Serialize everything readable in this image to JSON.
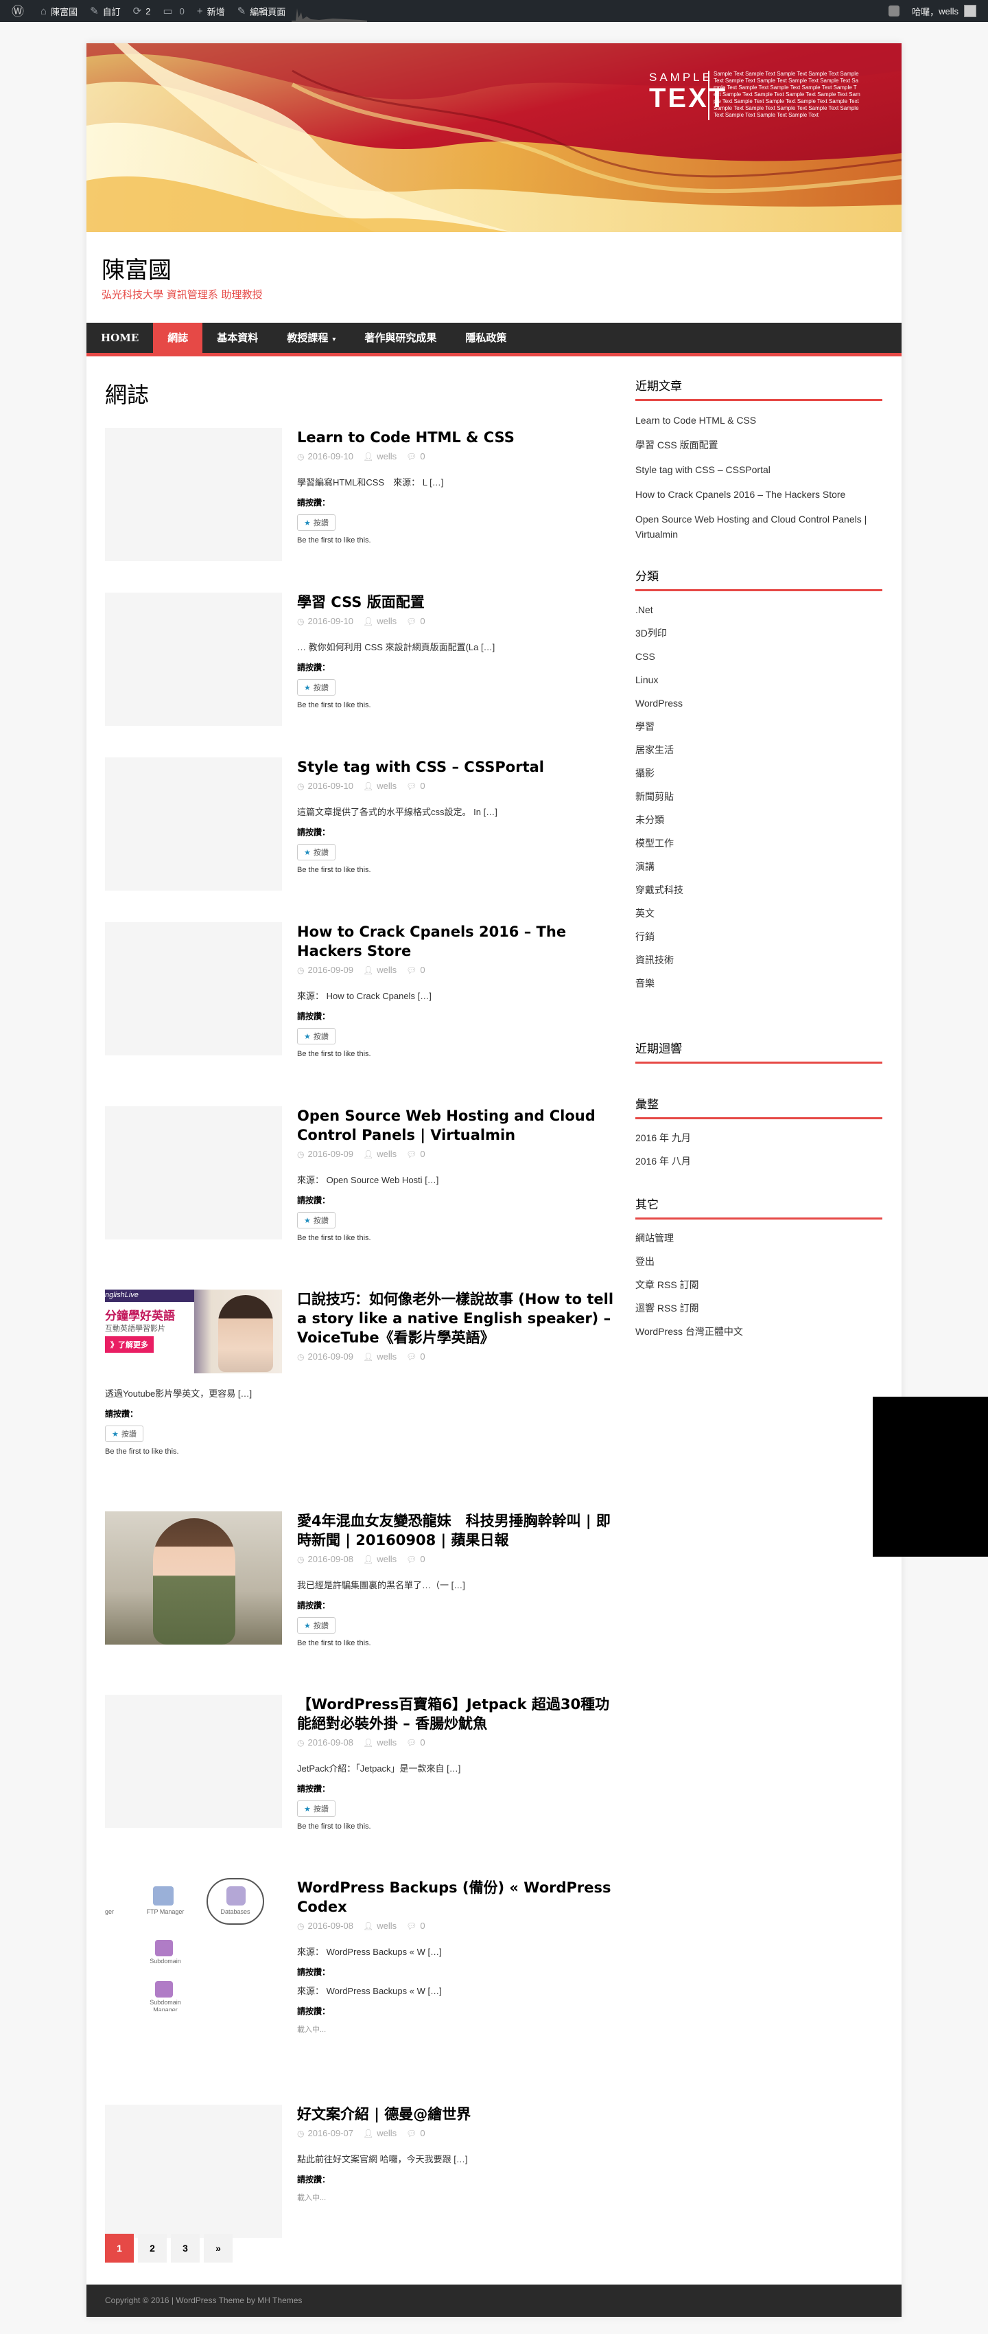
{
  "adminbar": {
    "site_name": "陳富國",
    "customize": "自訂",
    "updates_count": "2",
    "comments_count": "0",
    "new_label": "新增",
    "edit_label": "編輯頁面",
    "greeting": "哈囉，",
    "user": "wells"
  },
  "banner": {
    "brand_line1": "SAMPLE",
    "brand_line2": "TEXT",
    "sample_lines": [
      "Sample Text Sample Text Sample Text Sample Text Sample",
      "Text Sample Text Sample Text Sample Text Sample Text Sa",
      "mple Text Sample Text Sample Text Sample Text Sample T",
      "ext Sample Text Sample Text Sample Text Sample Text Sam",
      "ple Text Sample Text Sample Text Sample Text Sample Text",
      "Sample Text Sample Text Sample Text Sample Text Sample",
      "Text Sample Text Sample Text Sample Text"
    ],
    "colors": {
      "red": "#c1192a",
      "gold": "#f3c64b",
      "cream": "#fbefb7"
    }
  },
  "site": {
    "title": "陳富國",
    "description": "弘光科技大學 資訊管理系 助理教授"
  },
  "nav": {
    "items": [
      {
        "label": "HOME"
      },
      {
        "label": "網誌"
      },
      {
        "label": "基本資料"
      },
      {
        "label": "教授課程"
      },
      {
        "label": "著作與研究成果"
      },
      {
        "label": "隱私政策"
      }
    ]
  },
  "main": {
    "heading": "網誌",
    "rate_label": "請按讚：",
    "like_button": "按讚",
    "like_note": "Be the first to like this.",
    "loading": "載入中...",
    "posts": [
      {
        "title": "Learn to Code HTML & CSS",
        "date": "2016-09-10",
        "author": "wells",
        "comments": "0",
        "excerpt": "學習編寫HTML和CSS　來源：  L",
        "more": "[…]"
      },
      {
        "title": "學習 CSS 版面配置",
        "date": "2016-09-10",
        "author": "wells",
        "comments": "0",
        "excerpt": "… 教你如何利用 CSS 來設計網頁版面配置(La",
        "more": "[…]"
      },
      {
        "title": "Style tag with CSS – CSSPortal",
        "date": "2016-09-10",
        "author": "wells",
        "comments": "0",
        "excerpt": "這篇文章提供了各式的水平線格式css設定。 In",
        "more": "[…]"
      },
      {
        "title": "How to Crack Cpanels 2016 – The Hackers Store",
        "date": "2016-09-09",
        "author": "wells",
        "comments": "0",
        "excerpt": "來源：  How to Crack Cpanels",
        "more": "[…]"
      },
      {
        "title": "Open Source Web Hosting and Cloud Control Panels | Virtualmin",
        "date": "2016-09-09",
        "author": "wells",
        "comments": "0",
        "excerpt": "來源：  Open Source Web Hosti",
        "more": "[…]"
      },
      {
        "title": "口說技巧：如何像老外一樣說故事 (How to tell a story like a native English speaker) – VoiceTube《看影片學英語》",
        "date": "2016-09-09",
        "author": "wells",
        "comments": "0",
        "excerpt": "透過Youtube影片學英文，更容易",
        "more": "[…]",
        "thumb_text": {
          "brand": "nglishLive",
          "headline": "分鐘學好英語",
          "sub": "互動英語學習影片",
          "cta": "》了解更多"
        }
      },
      {
        "title": "愛4年混血女友變恐龍妹　科技男捶胸幹幹叫 | 即時新聞 | 20160908 | 蘋果日報",
        "date": "2016-09-08",
        "author": "wells",
        "comments": "0",
        "excerpt": " 我已經是許騙集團裏的黑名單了…（一",
        "more": "[…]"
      },
      {
        "title": "【WordPress百寶箱6】Jetpack 超過30種功能絕對必裝外掛 – 香腸炒魷魚",
        "date": "2016-09-08",
        "author": "wells",
        "comments": "0",
        "excerpt": "JetPack介紹：「Jetpack」是一款來自",
        "more": "[…]"
      },
      {
        "title": "WordPress Backups (備份) « WordPress Codex",
        "date": "2016-09-08",
        "author": "wells",
        "comments": "0",
        "excerpt": "來源：  WordPress Backups « W",
        "more": "[…]",
        "excerpt2": "來源：  WordPress Backups « W",
        "thumb_labels": [
          "FTP Manager",
          "Databases",
          "Subdomain",
          "Subdomain Manager",
          "ger"
        ]
      },
      {
        "title": "好文案介紹 | 德曼@繪世界",
        "date": "2016-09-07",
        "author": "wells",
        "comments": "0",
        "excerpt": " 點此前往好文案官網 哈囉，今天我要跟",
        "more": "[…]"
      }
    ]
  },
  "pagination": {
    "pages": [
      "1",
      "2",
      "3",
      "»"
    ]
  },
  "sidebar": {
    "recent_title": "近期文章",
    "recent": [
      "Learn to Code HTML & CSS",
      "學習 CSS 版面配置",
      "Style tag with CSS – CSSPortal",
      "How to Crack Cpanels 2016 – The Hackers Store",
      "Open Source Web Hosting and Cloud Control Panels | Virtualmin"
    ],
    "categories_title": "分類",
    "categories": [
      ".Net",
      "3D列印",
      "CSS",
      "Linux",
      "WordPress",
      "學習",
      "居家生活",
      "攝影",
      "新聞剪貼",
      "未分類",
      "模型工作",
      "演講",
      "穿戴式科技",
      "英文",
      "行銷",
      "資訊技術",
      "音樂"
    ],
    "comments_title": "近期迴響",
    "archives_title": "彙整",
    "archives": [
      "2016 年 九月",
      "2016 年 八月"
    ],
    "meta_title": "其它",
    "meta": [
      "網站管理",
      "登出",
      "文章 RSS 訂閱",
      "迴響 RSS 訂閱",
      "WordPress 台灣正體中文"
    ]
  },
  "footer": {
    "copyright": "Copyright © 2016 | WordPress Theme by MH Themes"
  }
}
